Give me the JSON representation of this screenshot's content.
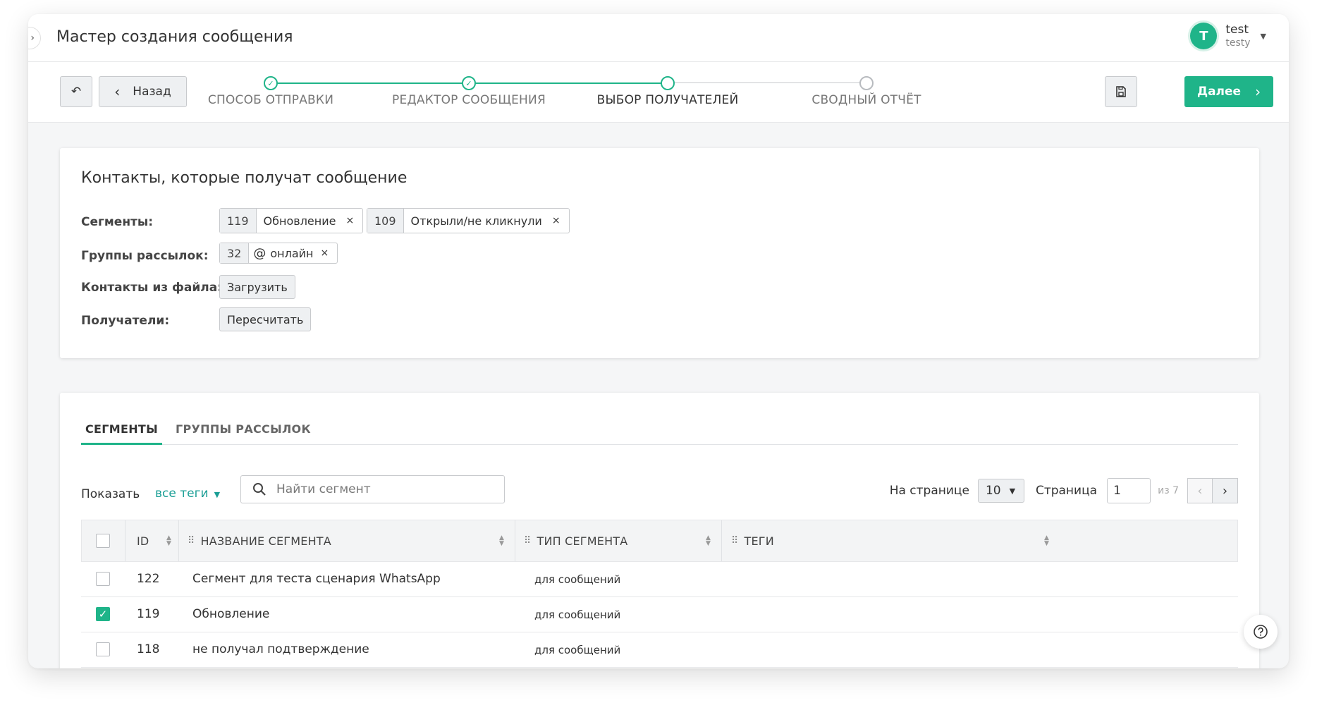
{
  "header": {
    "title": "Мастер создания сообщения",
    "collapse_glyph": "›",
    "user": {
      "avatar_letter": "T",
      "name": "test",
      "login": "testy"
    }
  },
  "toolbar": {
    "undo_glyph": "↶",
    "back_label": "Назад",
    "next_label": "Далее"
  },
  "steps": [
    {
      "label": "СПОСОБ ОТПРАВКИ",
      "state": "done"
    },
    {
      "label": "РЕДАКТОР СООБЩЕНИЯ",
      "state": "done"
    },
    {
      "label": "ВЫБОР ПОЛУЧАТЕЛЕЙ",
      "state": "active"
    },
    {
      "label": "СВОДНЫЙ ОТЧЁТ",
      "state": "todo"
    }
  ],
  "contacts": {
    "title": "Контакты, которые получат сообщение",
    "segments_label": "Сегменты:",
    "segments": [
      {
        "id": "119",
        "name": "Обновление"
      },
      {
        "id": "109",
        "name": "Открыли/не кликнули"
      }
    ],
    "groups_label": "Группы рассылок:",
    "groups": [
      {
        "id": "32",
        "name": "онлайн"
      }
    ],
    "file_label": "Контакты из файла:",
    "upload_label": "Загрузить",
    "recipients_label": "Получатели:",
    "recalc_label": "Пересчитать",
    "remove_glyph": "×"
  },
  "list": {
    "tabs": [
      "СЕГМЕНТЫ",
      "ГРУППЫ РАССЫЛОК"
    ],
    "show_label": "Показать",
    "tag_filter": "все теги",
    "search_placeholder": "Найти сегмент",
    "per_page_label": "На странице",
    "per_page": "10",
    "page_label": "Страница",
    "page": "1",
    "page_of": "из 7",
    "columns": [
      "ID",
      "НАЗВАНИЕ СЕГМЕНТА",
      "ТИП СЕГМЕНТА",
      "ТЕГИ"
    ],
    "rows": [
      {
        "id": "122",
        "name": "Сегмент для теста сценария WhatsApp",
        "type": "для сообщений",
        "tags": "",
        "checked": false
      },
      {
        "id": "119",
        "name": "Обновление",
        "type": "для сообщений",
        "tags": "",
        "checked": true
      },
      {
        "id": "118",
        "name": "не получал подтверждение",
        "type": "для сообщений",
        "tags": "",
        "checked": false
      }
    ]
  },
  "colors": {
    "accent": "#1fb489",
    "link": "#1a9e95"
  }
}
